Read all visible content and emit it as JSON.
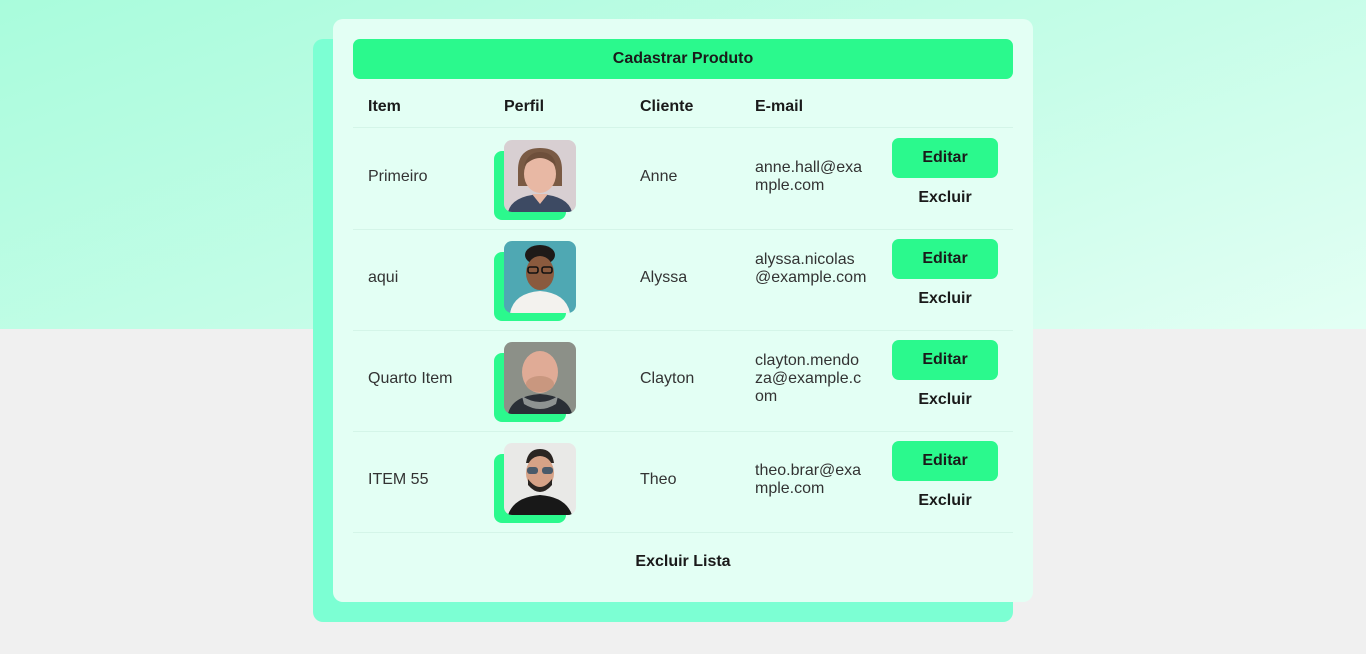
{
  "header": {
    "button_label": "Cadastrar Produto"
  },
  "columns": {
    "item": "Item",
    "perfil": "Perfil",
    "cliente": "Cliente",
    "email": "E-mail"
  },
  "rows": [
    {
      "item": "Primeiro",
      "cliente": "Anne",
      "email": "anne.hall@example.com",
      "edit_label": "Editar",
      "delete_label": "Excluir"
    },
    {
      "item": "aqui",
      "cliente": "Alyssa",
      "email": "alyssa.nicolas@example.com",
      "edit_label": "Editar",
      "delete_label": "Excluir"
    },
    {
      "item": "Quarto Item",
      "cliente": "Clayton",
      "email": "clayton.mendoza@example.com",
      "edit_label": "Editar",
      "delete_label": "Excluir"
    },
    {
      "item": "ITEM 55",
      "cliente": "Theo",
      "email": "theo.brar@example.com",
      "edit_label": "Editar",
      "delete_label": "Excluir"
    }
  ],
  "footer": {
    "delete_all_label": "Excluir Lista"
  },
  "colors": {
    "accent": "#2bf98d",
    "card_bg": "#e3fff4",
    "card_shadow": "#7cffd3",
    "page_bg": "#f0f0f0"
  }
}
